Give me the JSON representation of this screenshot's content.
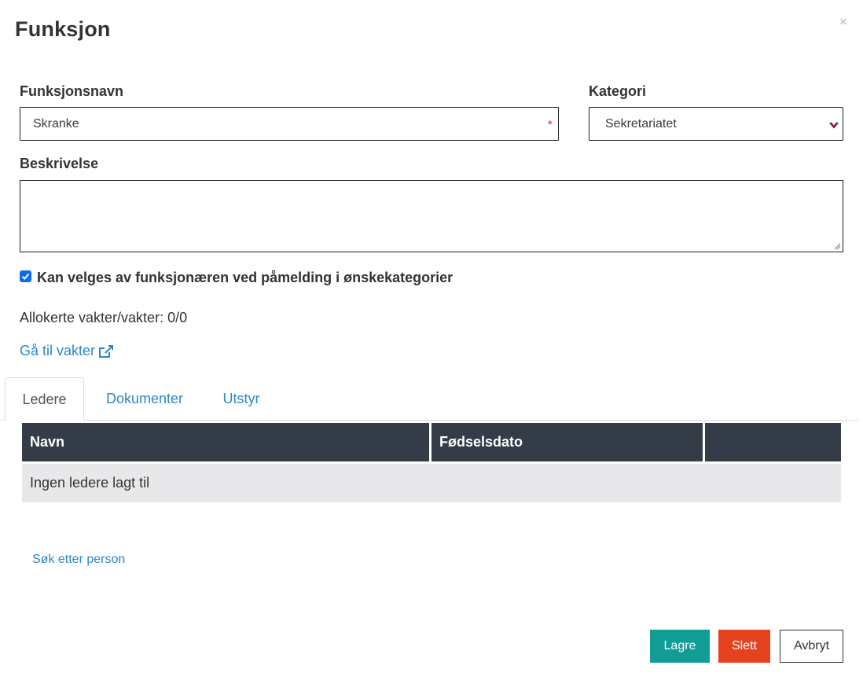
{
  "dialog": {
    "title": "Funksjon",
    "close_glyph": "×"
  },
  "form": {
    "name_label": "Funksjonsnavn",
    "name_value": "Skranke",
    "required_marker": "*",
    "category_label": "Kategori",
    "category_value": "Sekretariatet",
    "description_label": "Beskrivelse",
    "description_value": "",
    "selectable_checked": true,
    "selectable_label": "Kan velges av funksjonæren ved påmelding i ønskekategorier"
  },
  "allocation": {
    "text": "Allokerte vakter/vakter: 0/0"
  },
  "goto_shifts": {
    "label": "Gå til vakter",
    "icon": "external-link-icon"
  },
  "tabs": [
    {
      "label": "Ledere",
      "active": true
    },
    {
      "label": "Dokumenter",
      "active": false
    },
    {
      "label": "Utstyr",
      "active": false
    }
  ],
  "leaders_table": {
    "columns": [
      "Navn",
      "Fødselsdato",
      ""
    ],
    "empty_message": "Ingen ledere lagt til"
  },
  "search_person": {
    "label": "Søk etter person"
  },
  "actions": {
    "save": "Lagre",
    "delete": "Slett",
    "cancel": "Avbryt"
  },
  "colors": {
    "link": "#2b87c8",
    "save": "#119d96",
    "delete": "#e5431f",
    "table_header": "#343d47",
    "required": "#e4203a",
    "checkbox": "#0b6cf0"
  }
}
